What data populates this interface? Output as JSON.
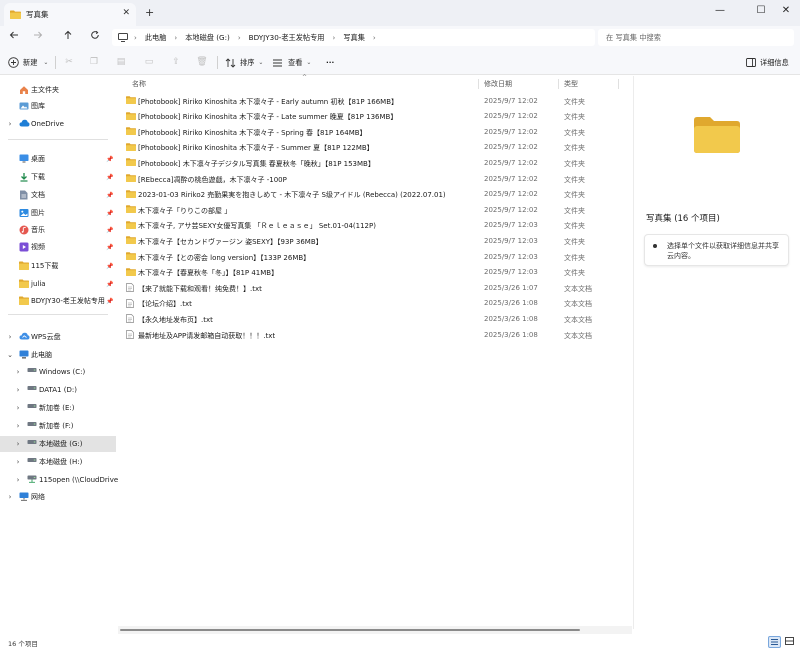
{
  "window": {
    "tab_title": "写真集",
    "tab_close": "✕",
    "new_tab": "+",
    "minimize": "—",
    "maximize": "☐",
    "close": "✕"
  },
  "address": {
    "crumbs": [
      "此电脑",
      "本地磁盘 (G:)",
      "BDYJY30-老王发帖专用",
      "写真集"
    ],
    "search_placeholder": "在 写真集 中搜索"
  },
  "toolbar": {
    "new_label": "新建",
    "sort_label": "排序",
    "view_label": "查看",
    "more_label": "···",
    "details_label": "详细信息"
  },
  "sidebar": {
    "items": [
      {
        "label": "主文件夹",
        "icon": "home-icon"
      },
      {
        "label": "图库",
        "icon": "gallery-icon"
      },
      {
        "label": "OneDrive",
        "icon": "cloud-icon",
        "chevron": true
      },
      {
        "label": "桌面",
        "icon": "desktop-icon",
        "pinned": true
      },
      {
        "label": "下载",
        "icon": "download-icon",
        "pinned": true
      },
      {
        "label": "文档",
        "icon": "document-icon",
        "pinned": true
      },
      {
        "label": "图片",
        "icon": "picture-icon",
        "pinned": true
      },
      {
        "label": "音乐",
        "icon": "music-icon",
        "pinned": true
      },
      {
        "label": "视频",
        "icon": "video-icon",
        "pinned": true
      },
      {
        "label": "115下载",
        "icon": "folder-icon",
        "pinned": true
      },
      {
        "label": "julia",
        "icon": "folder-icon",
        "pinned": true
      },
      {
        "label": "BDYJY30-老王发帖专用",
        "icon": "folder-icon",
        "pinned": true
      },
      {
        "label": "WPS云盘",
        "icon": "wps-cloud-icon",
        "chevron": true
      },
      {
        "label": "此电脑",
        "icon": "computer-icon",
        "chevron": true,
        "expanded": true
      },
      {
        "label": "Windows (C:)",
        "icon": "drive-icon",
        "chevron": true,
        "indent": true
      },
      {
        "label": "DATA1 (D:)",
        "icon": "drive-icon",
        "chevron": true,
        "indent": true
      },
      {
        "label": "新加卷 (E:)",
        "icon": "drive-icon",
        "chevron": true,
        "indent": true
      },
      {
        "label": "新加卷 (F:)",
        "icon": "drive-icon",
        "chevron": true,
        "indent": true
      },
      {
        "label": "本地磁盘 (G:)",
        "icon": "drive-icon",
        "chevron": true,
        "indent": true,
        "selected": true
      },
      {
        "label": "本地磁盘 (H:)",
        "icon": "drive-icon",
        "chevron": true,
        "indent": true
      },
      {
        "label": "115open (\\\\CloudDrive)",
        "icon": "network-drive-icon",
        "chevron": true,
        "indent": true
      },
      {
        "label": "网络",
        "icon": "network-icon",
        "chevron": true
      }
    ]
  },
  "columns": {
    "name": "名称",
    "date": "修改日期",
    "type": "类型"
  },
  "files": [
    {
      "name": "[Photobook] Ririko Kinoshita 木下凛々子 - Early autumn 初秋【81P 166MB】",
      "date": "2025/9/7 12:02",
      "type": "文件夹",
      "kind": "folder"
    },
    {
      "name": "[Photobook] Ririko Kinoshita 木下凛々子 - Late summer 晚夏【81P 136MB】",
      "date": "2025/9/7 12:02",
      "type": "文件夹",
      "kind": "folder"
    },
    {
      "name": "[Photobook] Ririko Kinoshita 木下凛々子 - Spring 春【81P 164MB】",
      "date": "2025/9/7 12:02",
      "type": "文件夹",
      "kind": "folder"
    },
    {
      "name": "[Photobook] Ririko Kinoshita 木下凛々子 - Summer 夏【81P 122MB】",
      "date": "2025/9/7 12:02",
      "type": "文件夹",
      "kind": "folder"
    },
    {
      "name": "[Photobook] 木下凛々子デジタル写真集 春夏秋冬「晚秋」【81P 153MB】",
      "date": "2025/9/7 12:02",
      "type": "文件夹",
      "kind": "folder"
    },
    {
      "name": "[REbecca]凋酔の桃色遊戯，木下凛々子 -100P",
      "date": "2025/9/7 12:02",
      "type": "文件夹",
      "kind": "folder"
    },
    {
      "name": "2023-01-03 Ririko2 売勤果実を抱きしめて - 木下凛々子 S级アイドル (Rebecca) (2022.07.01)",
      "date": "2025/9/7 12:02",
      "type": "文件夹",
      "kind": "folder"
    },
    {
      "name": "木下凛々子「りりこの部屋 」",
      "date": "2025/9/7 12:02",
      "type": "文件夹",
      "kind": "folder"
    },
    {
      "name": "木下凛々子, アサ芸SEXY女優写真集 「Ｒｅｌｅａｓｅ」 Set.01-04(112P)",
      "date": "2025/9/7 12:03",
      "type": "文件夹",
      "kind": "folder"
    },
    {
      "name": "木下凛々子【セカンドヴァージン 姿SEXY】【93P 36MB】",
      "date": "2025/9/7 12:03",
      "type": "文件夹",
      "kind": "folder"
    },
    {
      "name": "木下凛々子【との密会 long version】【133P 26MB】",
      "date": "2025/9/7 12:03",
      "type": "文件夹",
      "kind": "folder"
    },
    {
      "name": "木下凛々子【春夏秋冬「冬」】【81P 41MB】",
      "date": "2025/9/7 12:03",
      "type": "文件夹",
      "kind": "folder"
    },
    {
      "name": "【来了就能下载和观看！纯免费！】.txt",
      "date": "2025/3/26 1:07",
      "type": "文本文档",
      "kind": "text"
    },
    {
      "name": "【论坛介绍】.txt",
      "date": "2025/3/26 1:08",
      "type": "文本文档",
      "kind": "text"
    },
    {
      "name": "【永久地址发布页】.txt",
      "date": "2025/3/26 1:08",
      "type": "文本文档",
      "kind": "text"
    },
    {
      "name": "最新地址及APP请发邮箱自动获取！！！.txt",
      "date": "2025/3/26 1:08",
      "type": "文本文档",
      "kind": "text"
    }
  ],
  "details": {
    "title": "写真集 (16 个项目)",
    "hint": "选择单个文件以获取详细信息并共享云内容。"
  },
  "status": {
    "count": "16 个项目"
  },
  "colors": {
    "folder": "#f2c94c",
    "folder_dark": "#e0a82e",
    "accent": "#0067c0",
    "selected_bg": "#e3e3e3"
  }
}
